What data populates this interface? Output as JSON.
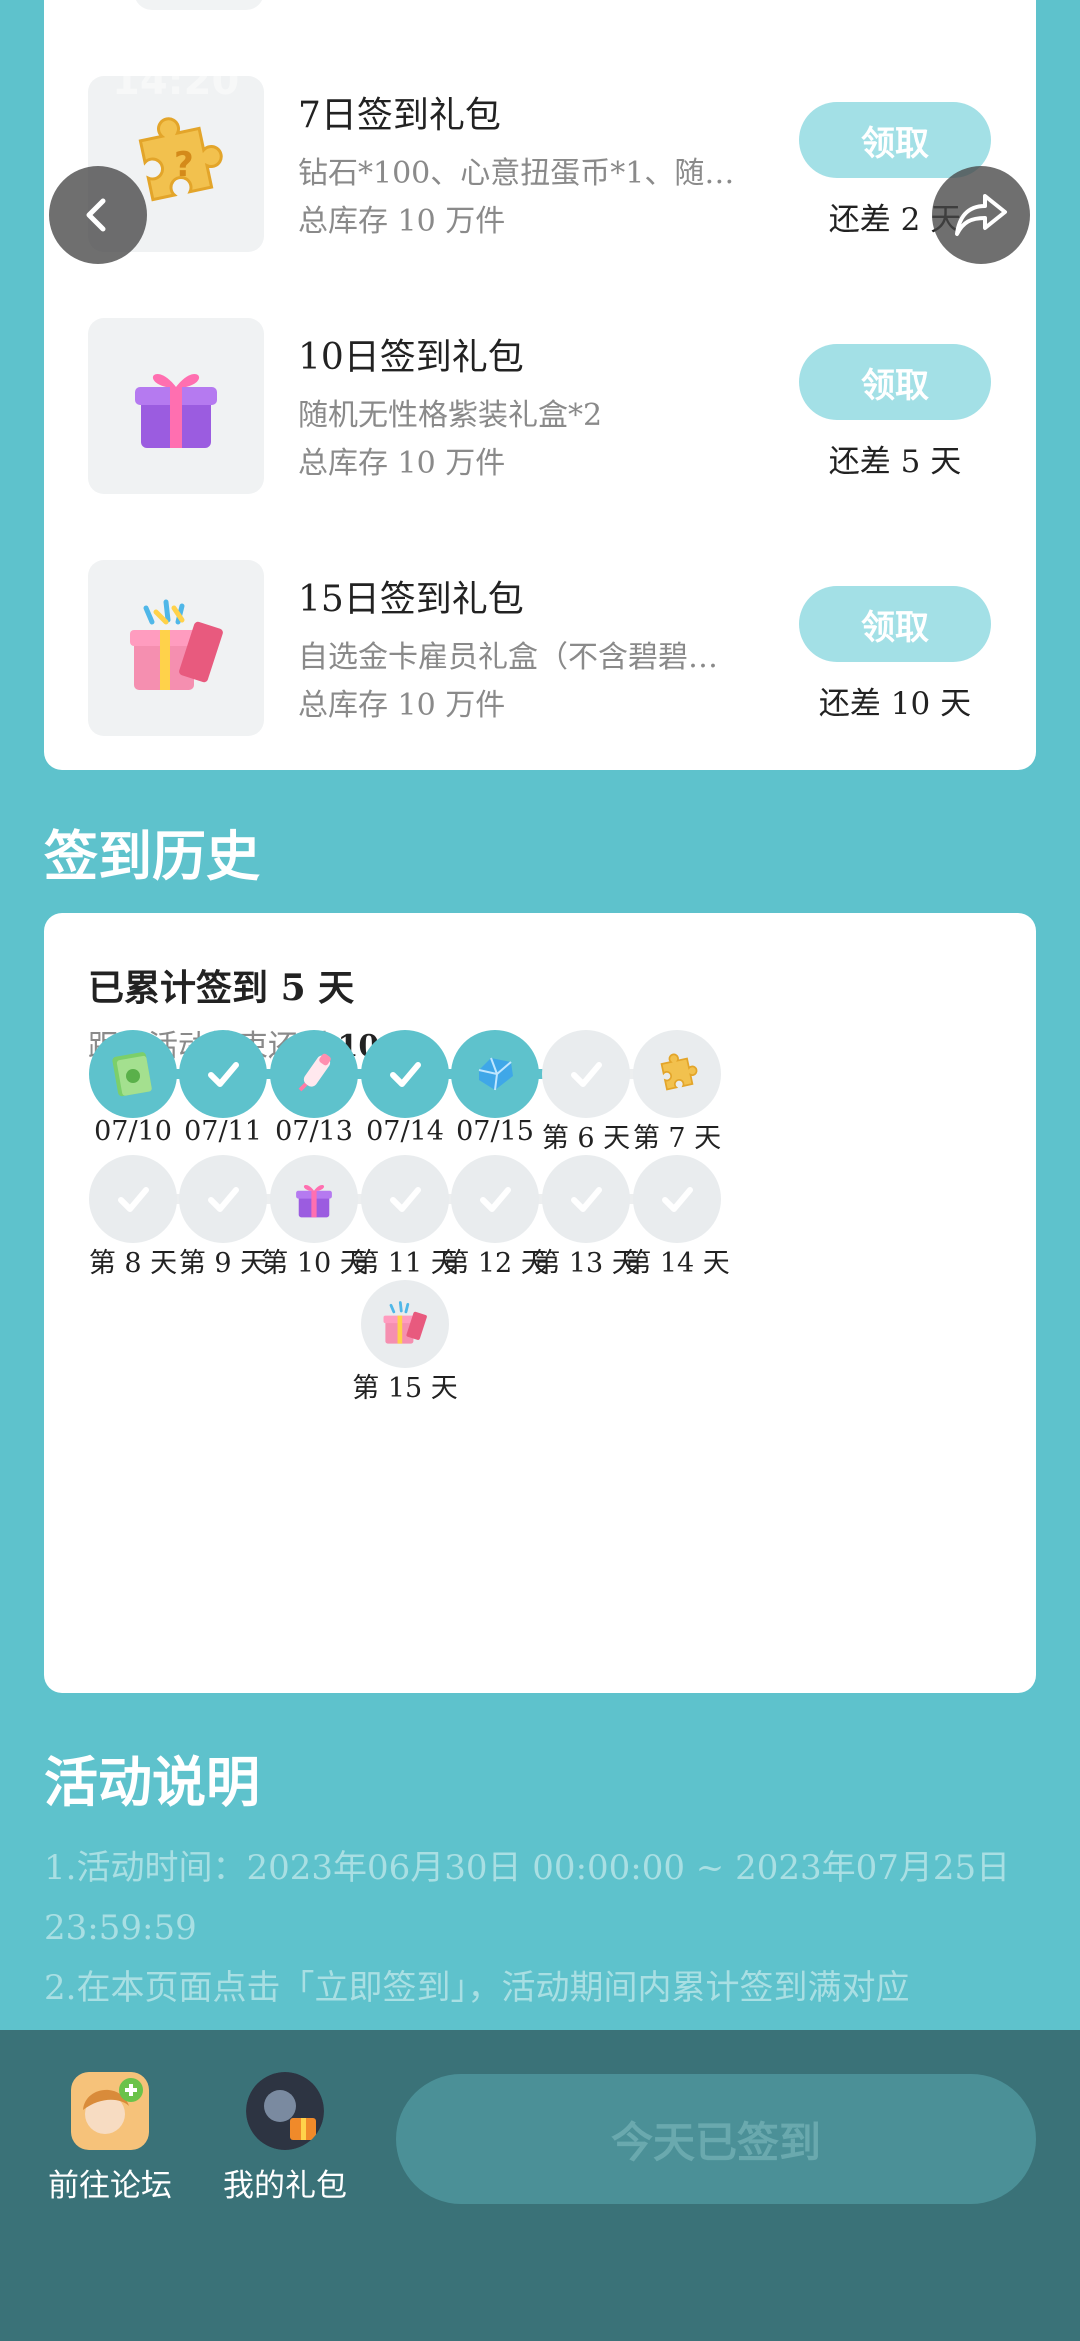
{
  "status_bar": {
    "time": "14:20"
  },
  "gifts": [
    {
      "title": "7日签到礼包",
      "desc": "钻石*100、心意扭蛋币*1、随机…",
      "stock": "总库存 10 万件",
      "button": "领取",
      "remain": "还差 2 天",
      "icon": "puzzle-piece-icon"
    },
    {
      "title": "10日签到礼包",
      "desc": "随机无性格紫装礼盒*2",
      "stock": "总库存 10 万件",
      "button": "领取",
      "remain": "还差 5 天",
      "icon": "purple-gift-box-icon"
    },
    {
      "title": "15日签到礼包",
      "desc": "自选金卡雇员礼盒（不含碧碧…",
      "stock": "总库存 10 万件",
      "button": "领取",
      "remain": "还差 10 天",
      "icon": "pink-gift-box-icon"
    }
  ],
  "history": {
    "section_title": "签到历史",
    "heading_prefix": "已累计签到",
    "heading_count": "5",
    "heading_suffix": "天",
    "sub_prefix": "距离活动结束还剩",
    "sub_count": "10",
    "sub_suffix": "天",
    "days": [
      {
        "label": "07/10",
        "done": true,
        "icon": "cash-icon"
      },
      {
        "label": "07/11",
        "done": true,
        "icon": "check-icon"
      },
      {
        "label": "07/13",
        "done": true,
        "icon": "bottle-icon"
      },
      {
        "label": "07/14",
        "done": true,
        "icon": "check-icon"
      },
      {
        "label": "07/15",
        "done": true,
        "icon": "diamond-icon"
      },
      {
        "label": "第 6 天",
        "done": false,
        "icon": "check-icon"
      },
      {
        "label": "第 7 天",
        "done": false,
        "icon": "puzzle-piece-icon"
      },
      {
        "label": "第 8 天",
        "done": false,
        "icon": "check-icon"
      },
      {
        "label": "第 9 天",
        "done": false,
        "icon": "check-icon"
      },
      {
        "label": "第 10 天",
        "done": false,
        "icon": "purple-gift-box-icon"
      },
      {
        "label": "第 11 天",
        "done": false,
        "icon": "check-icon"
      },
      {
        "label": "第 12 天",
        "done": false,
        "icon": "check-icon"
      },
      {
        "label": "第 13 天",
        "done": false,
        "icon": "check-icon"
      },
      {
        "label": "第 14 天",
        "done": false,
        "icon": "check-icon"
      },
      {
        "label": "第 15 天",
        "done": false,
        "icon": "pink-gift-box-icon"
      }
    ]
  },
  "rules": {
    "section_title": "活动说明",
    "line1": "1.活动时间：2023年06月30日 00:00:00 ~ 2023年07月25日 23:59:59",
    "line2": "2.在本页面点击「立即签到」，活动期间内累计签到满对应"
  },
  "bottom_bar": {
    "forum_label": "前往论坛",
    "gifts_label": "我的礼包",
    "signed_button": "今天已签到"
  },
  "colors": {
    "teal": "#5ec2cc",
    "claim_button": "#a3e0e6",
    "bottom_bar": "#3a7278"
  }
}
